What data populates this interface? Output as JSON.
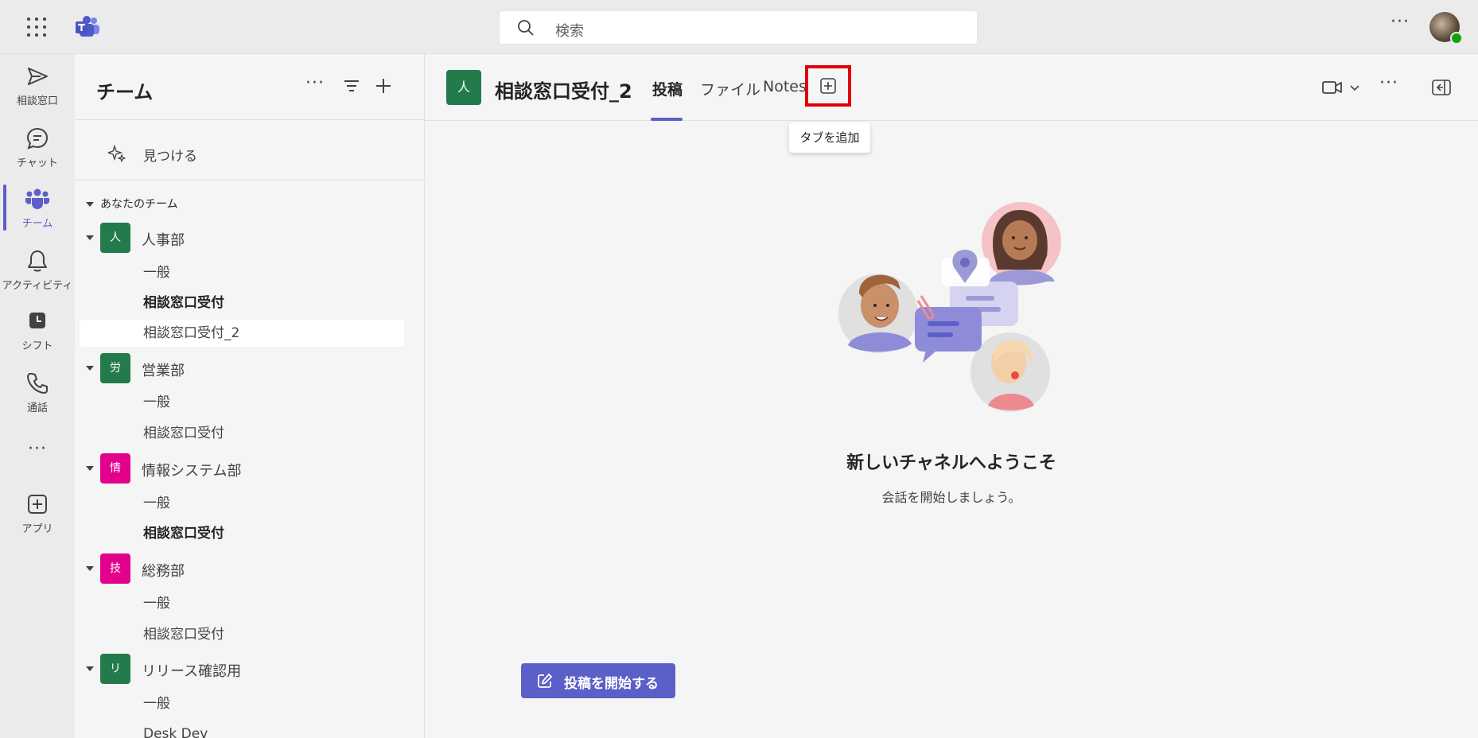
{
  "topbar": {
    "search_placeholder": "検索",
    "more_label": "···"
  },
  "rail": {
    "items": [
      {
        "label": "相談窓口",
        "icon": "send-icon"
      },
      {
        "label": "チャット",
        "icon": "chat-icon"
      },
      {
        "label": "チーム",
        "icon": "teams-icon"
      },
      {
        "label": "アクティビティ",
        "icon": "bell-icon"
      },
      {
        "label": "シフト",
        "icon": "shifts-icon"
      },
      {
        "label": "通話",
        "icon": "phone-icon"
      },
      {
        "label": "アプリ",
        "icon": "apps-icon"
      }
    ],
    "more_label": "···"
  },
  "sidebar": {
    "title": "チーム",
    "more_label": "···",
    "discover_label": "見つける",
    "section_label": "あなたのチーム",
    "teams": [
      {
        "initial": "人",
        "name": "人事部",
        "color": "#237b4b",
        "channels": [
          "一般",
          "相談窓口受付",
          "相談窓口受付_2"
        ]
      },
      {
        "initial": "労",
        "name": "営業部",
        "color": "#237b4b",
        "channels": [
          "一般",
          "相談窓口受付"
        ]
      },
      {
        "initial": "情",
        "name": "情報システム部",
        "color": "#e3008c",
        "channels": [
          "一般",
          "相談窓口受付"
        ]
      },
      {
        "initial": "技",
        "name": "総務部",
        "color": "#e3008c",
        "channels": [
          "一般",
          "相談窓口受付"
        ]
      },
      {
        "initial": "リ",
        "name": "リリース確認用",
        "color": "#237b4b",
        "channels": [
          "一般",
          "Desk Dev"
        ]
      }
    ]
  },
  "main": {
    "channel_initial": "人",
    "channel_title": "相談窓口受付_2",
    "tabs": [
      "投稿",
      "ファイル",
      "Notes"
    ],
    "add_tab_tooltip": "タブを追加",
    "more_label": "···",
    "welcome_title": "新しいチャネルへようこそ",
    "welcome_subtitle": "会話を開始しましょう。",
    "start_post_button": "投稿を開始する"
  },
  "colors": {
    "accent": "#5b5fc7",
    "highlight_box": "#e0000b"
  }
}
